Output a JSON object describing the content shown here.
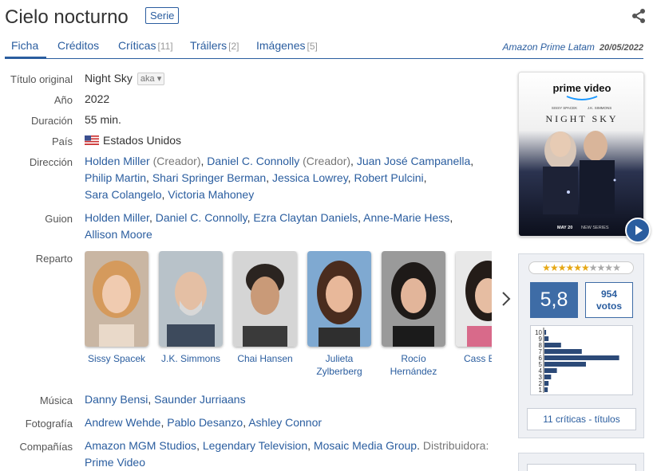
{
  "header": {
    "title": "Cielo nocturno",
    "type_badge": "Serie"
  },
  "tabs": [
    {
      "label": "Ficha",
      "count": ""
    },
    {
      "label": "Créditos",
      "count": ""
    },
    {
      "label": "Críticas",
      "count": "[11]"
    },
    {
      "label": "Tráilers",
      "count": "[2]"
    },
    {
      "label": "Imágenes",
      "count": "[5]"
    }
  ],
  "provider": {
    "name": "Amazon Prime Latam",
    "date": "20/05/2022"
  },
  "info": {
    "original_title_label": "Título original",
    "original_title": "Night Sky",
    "aka_label": "aka",
    "year_label": "Año",
    "year": "2022",
    "duration_label": "Duración",
    "duration": "55 min.",
    "country_label": "País",
    "country": "Estados Unidos",
    "direction_label": "Dirección",
    "direction": [
      {
        "name": "Holden Miller",
        "role": " (Creador)"
      },
      {
        "name": "Daniel C. Connolly",
        "role": " (Creador)"
      },
      {
        "name": "Juan José Campanella",
        "role": ""
      },
      {
        "name": "Philip Martin",
        "role": ""
      },
      {
        "name": "Shari Springer Berman",
        "role": ""
      },
      {
        "name": "Jessica Lowrey",
        "role": ""
      },
      {
        "name": "Robert Pulcini",
        "role": ""
      },
      {
        "name": "Sara Colangelo",
        "role": ""
      },
      {
        "name": "Victoria Mahoney",
        "role": ""
      }
    ],
    "script_label": "Guion",
    "script": [
      "Holden Miller",
      "Daniel C. Connolly",
      "Ezra Claytan Daniels",
      "Anne-Marie Hess",
      "Allison Moore"
    ],
    "cast_label": "Reparto",
    "cast": [
      {
        "line1": "Sissy Spacek",
        "line2": ""
      },
      {
        "line1": "J.K. Simmons",
        "line2": ""
      },
      {
        "line1": "Chai Hansen",
        "line2": ""
      },
      {
        "line1": "Julieta",
        "line2": "Zylberberg"
      },
      {
        "line1": "Rocío",
        "line2": "Hernández"
      },
      {
        "line1": "Cass B",
        "line2": ""
      }
    ],
    "music_label": "Música",
    "music": [
      "Danny Bensi",
      "Saunder Jurriaans"
    ],
    "photo_label": "Fotografía",
    "photo": [
      "Andrew Wehde",
      "Pablo Desanzo",
      "Ashley Connor"
    ],
    "companies_label": "Compañías",
    "companies": [
      "Amazon MGM Studios",
      "Legendary Television",
      "Mosaic Media Group"
    ],
    "distributor_label": "Distribuidora:",
    "distributor": "Prime Video"
  },
  "poster": {
    "brand": "prime video",
    "actor1": "SISSY SPACEK",
    "actor2": "J.K. SIMMONS",
    "title": "NIGHT SKY",
    "footer_date": "MAY 20",
    "footer_tag": "NEW SERIES"
  },
  "rating": {
    "stars_filled": 6,
    "stars_total": 10,
    "average": "5,8",
    "votes": "954",
    "votes_label": "votos",
    "histogram_labels": [
      "10",
      "9",
      "8",
      "7",
      "6",
      "5",
      "4",
      "3",
      "2",
      "1"
    ],
    "histogram_fractions": [
      0.02,
      0.05,
      0.2,
      0.45,
      0.9,
      0.5,
      0.15,
      0.08,
      0.05,
      0.04
    ],
    "critics_link": "11 críticas - títulos"
  },
  "colors": {
    "link": "#2a5d9f",
    "score_bg": "#3e6ca6",
    "star": "#e6a817"
  }
}
